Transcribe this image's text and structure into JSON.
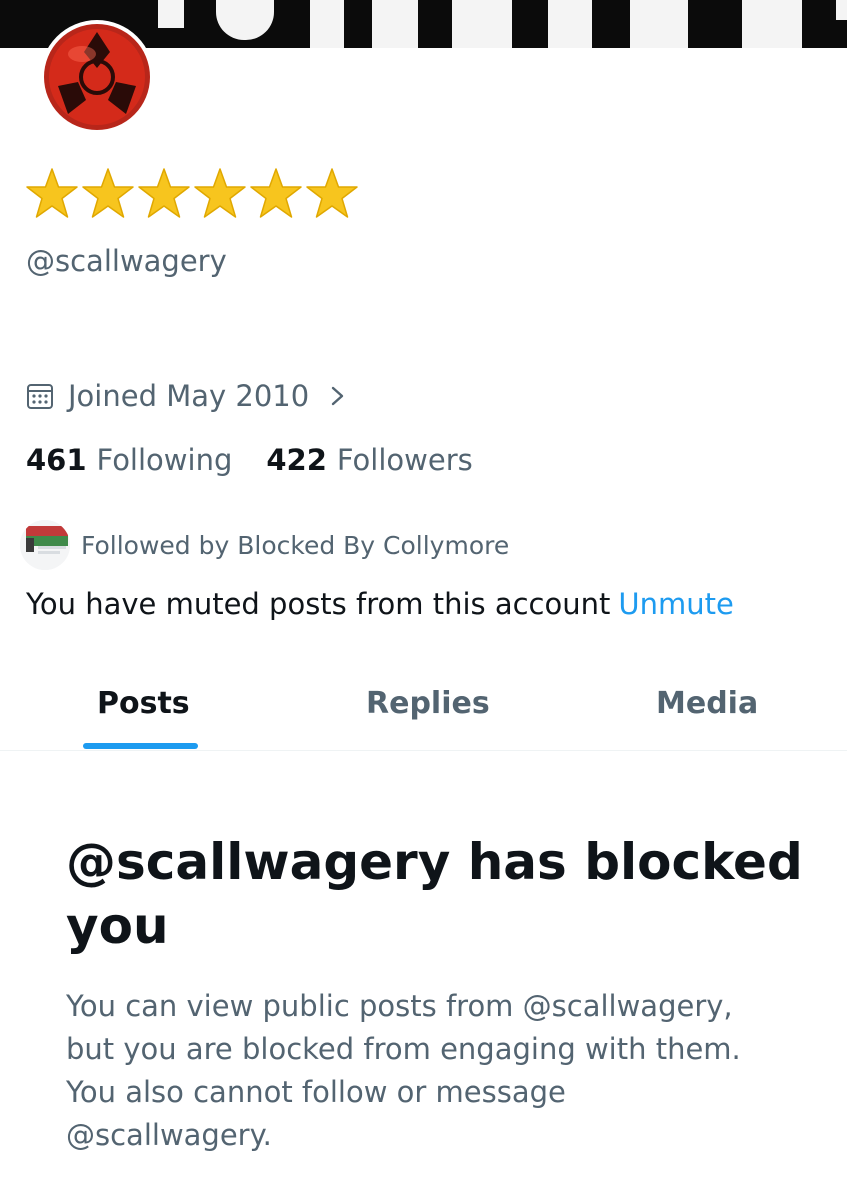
{
  "profile": {
    "display_name_icons": [
      "star-icon",
      "star-icon",
      "star-icon",
      "star-icon",
      "star-icon",
      "star-icon"
    ],
    "handle": "@scallwagery",
    "joined": "Joined May 2010",
    "following_count": "461",
    "following_label": "Following",
    "followers_count": "422",
    "followers_label": "Followers",
    "followed_by": "Followed by Blocked By Collymore",
    "muted_notice": "You have muted posts from this account",
    "unmute_label": "Unmute"
  },
  "tabs": [
    {
      "label": "Posts",
      "active": true
    },
    {
      "label": "Replies",
      "active": false
    },
    {
      "label": "Media",
      "active": false
    }
  ],
  "blocked": {
    "title": "@scallwagery has blocked you",
    "body": "You can view public posts from @scallwagery, but you are blocked from engaging with them. You also cannot follow or message @scallwagery."
  },
  "colors": {
    "accent": "#1d9bf0",
    "text_primary": "#0f1419",
    "text_secondary": "#536471",
    "star": "#f7c51e",
    "avatar_ball": "#d42a1a"
  }
}
